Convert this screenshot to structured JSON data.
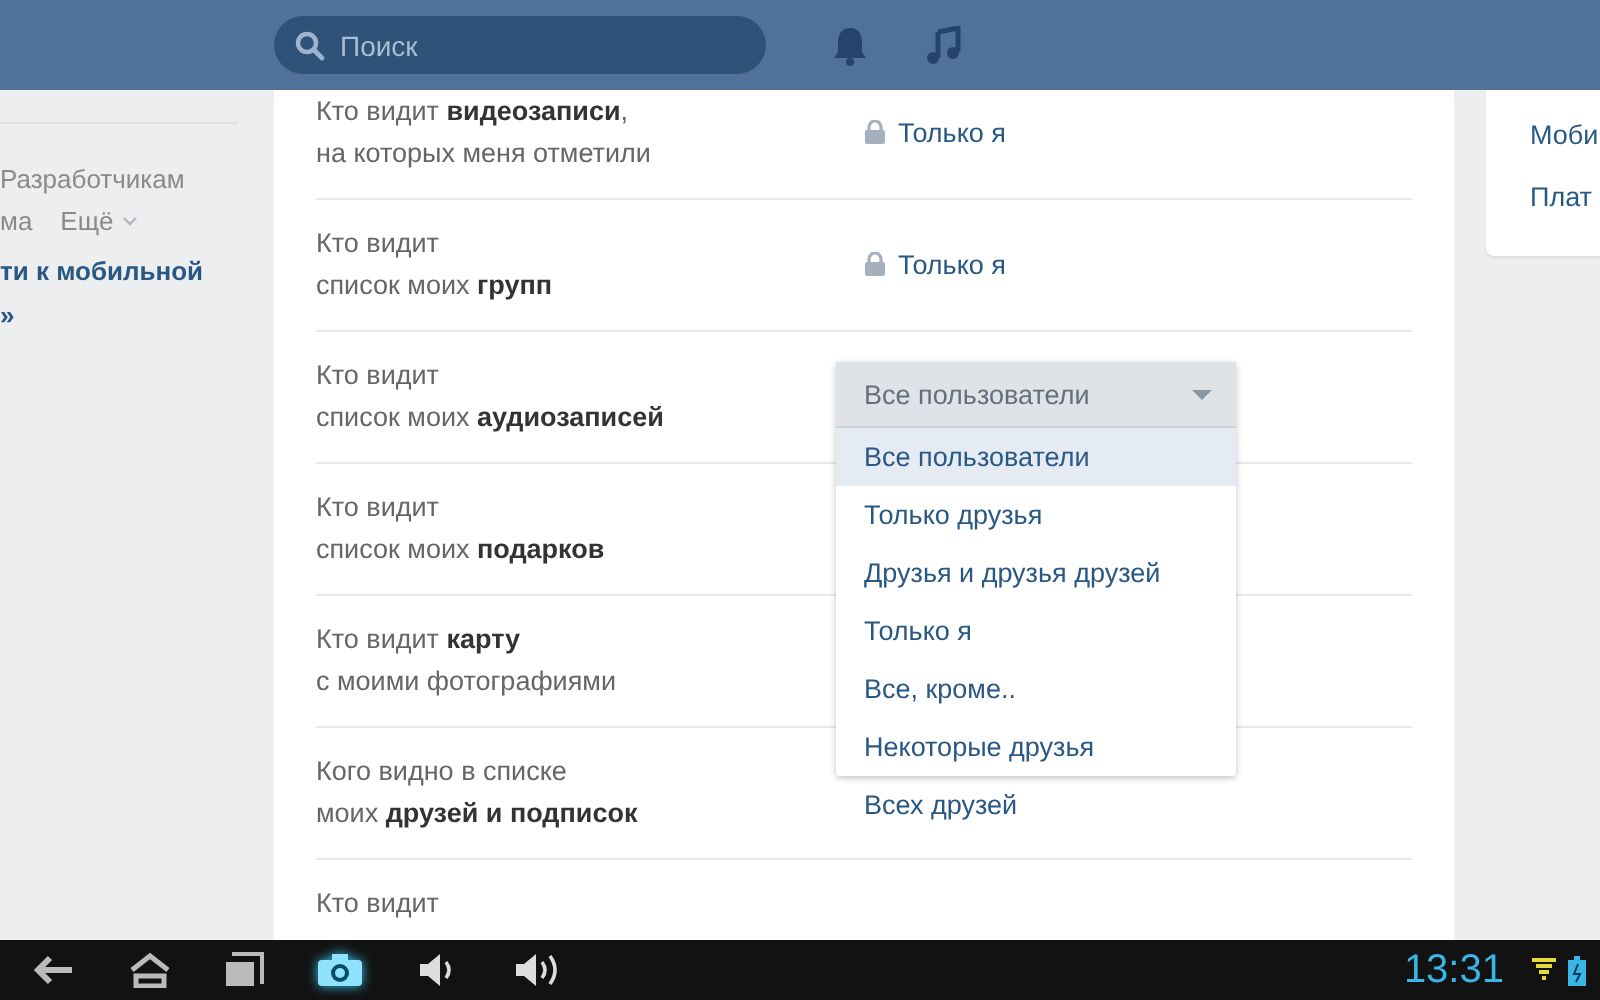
{
  "header": {
    "search": {
      "placeholder": "Поиск"
    }
  },
  "sidebar": {
    "links": [
      {
        "text": "Разработчикам",
        "kind": "plain"
      },
      {
        "text": "ма",
        "kind": "plain"
      },
      {
        "text": "Ещё",
        "kind": "more"
      }
    ],
    "promo": [
      "ти к мобильной",
      "»"
    ]
  },
  "settings": [
    {
      "label": "Кто видит **видеозаписи**,\nна которых меня отметили",
      "value": {
        "kind": "lock",
        "text": "Только я"
      }
    },
    {
      "label": "Кто видит\nсписок моих **групп**",
      "value": {
        "kind": "lock",
        "text": "Только я"
      }
    },
    {
      "label": "Кто видит\nсписок моих **аудиозаписей**",
      "value": {
        "kind": "dropdown",
        "text": "Все пользователи"
      }
    },
    {
      "label": "Кто видит\nсписок моих **подарков**",
      "value": {
        "kind": "hidden"
      }
    },
    {
      "label": "Кто видит **карту**\nс моими фотографиями",
      "value": {
        "kind": "hidden"
      }
    },
    {
      "label": "Кого видно в списке\nмоих **друзей и подписок**",
      "value": {
        "kind": "text",
        "text": "Всех друзей"
      }
    },
    {
      "label": "Кто видит",
      "value": {
        "kind": "hidden"
      }
    }
  ],
  "dropdown_options": [
    {
      "text": "Все пользователи",
      "selected": true
    },
    {
      "text": "Только друзья",
      "selected": false
    },
    {
      "text": "Друзья и друзья друзей",
      "selected": false
    },
    {
      "text": "Только я",
      "selected": false
    },
    {
      "text": "Все, кроме..",
      "selected": false
    },
    {
      "text": "Некоторые друзья",
      "selected": false
    }
  ],
  "right_menu": [
    "Моби",
    "Плат"
  ],
  "status_bar": {
    "time": "13:31"
  }
}
